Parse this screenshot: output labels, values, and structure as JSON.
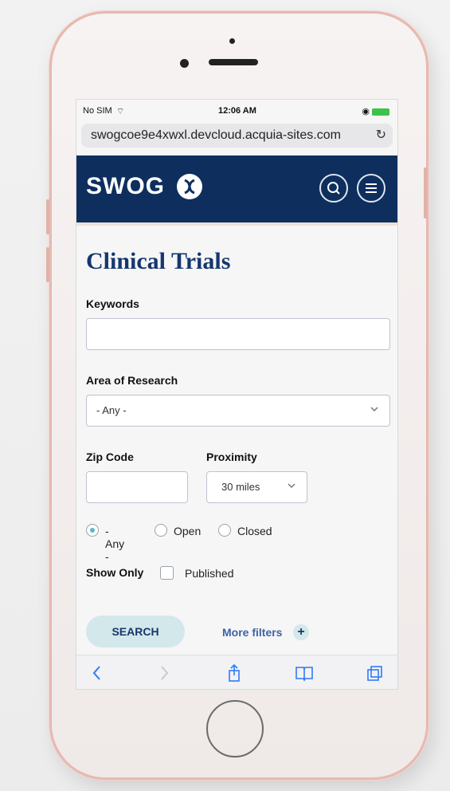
{
  "status_bar": {
    "carrier": "No SIM",
    "time": "12:06 AM"
  },
  "browser": {
    "url": "swogcoe9e4xwxl.devcloud.acquia-sites.com",
    "reload_icon": "reload-icon",
    "toolbar_icons": [
      "back-icon",
      "forward-icon",
      "share-icon",
      "bookmarks-icon",
      "tabs-icon"
    ]
  },
  "header": {
    "logo_text": "SWOG",
    "logo_icon": "swog-logo-icon",
    "search_icon": "search-icon",
    "menu_icon": "menu-icon",
    "colors": {
      "brand": "#0e2f5e",
      "accent": "#d3e8eb"
    }
  },
  "page": {
    "title": "Clinical Trials",
    "keywords": {
      "label": "Keywords",
      "value": ""
    },
    "area_of_research": {
      "label": "Area of Research",
      "selected": "- Any -"
    },
    "zip_code": {
      "label": "Zip Code",
      "value": ""
    },
    "proximity": {
      "label": "Proximity",
      "selected": "30 miles"
    },
    "status_radios": [
      {
        "label": "- Any -",
        "selected": true
      },
      {
        "label": "Open",
        "selected": false
      },
      {
        "label": "Closed",
        "selected": false
      }
    ],
    "show_only": {
      "label": "Show Only",
      "option": "Published",
      "checked": false
    },
    "search_button": "SEARCH",
    "more_filters": "More filters",
    "plus_icon": "plus-icon"
  }
}
